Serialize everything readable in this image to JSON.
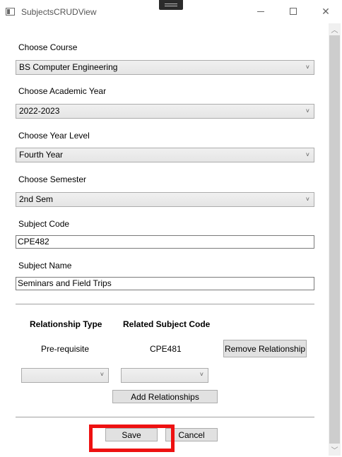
{
  "window": {
    "title": "SubjectsCRUDView"
  },
  "form": {
    "course": {
      "label": "Choose Course",
      "value": "BS Computer Engineering"
    },
    "academic_year": {
      "label": "Choose Academic Year",
      "value": "2022-2023"
    },
    "year_level": {
      "label": "Choose Year Level",
      "value": "Fourth Year"
    },
    "semester": {
      "label": "Choose Semester",
      "value": "2nd Sem"
    },
    "subject_code": {
      "label": "Subject Code",
      "value": "CPE482"
    },
    "subject_name": {
      "label": "Subject Name",
      "value": "Seminars and Field Trips"
    }
  },
  "relationships": {
    "headers": {
      "type": "Relationship Type",
      "code": "Related Subject Code"
    },
    "rows": [
      {
        "type": "Pre-requisite",
        "code": "CPE481",
        "action": "Remove Relationship"
      }
    ],
    "add_label": "Add Relationships"
  },
  "actions": {
    "save_label": "Save",
    "cancel_label": "Cancel"
  },
  "icons": {
    "minimize": "minimize-icon",
    "maximize": "maximize-icon",
    "close": "close-icon",
    "dropdown": "chevron-down-icon"
  },
  "colors": {
    "highlight": "#ee1111"
  }
}
